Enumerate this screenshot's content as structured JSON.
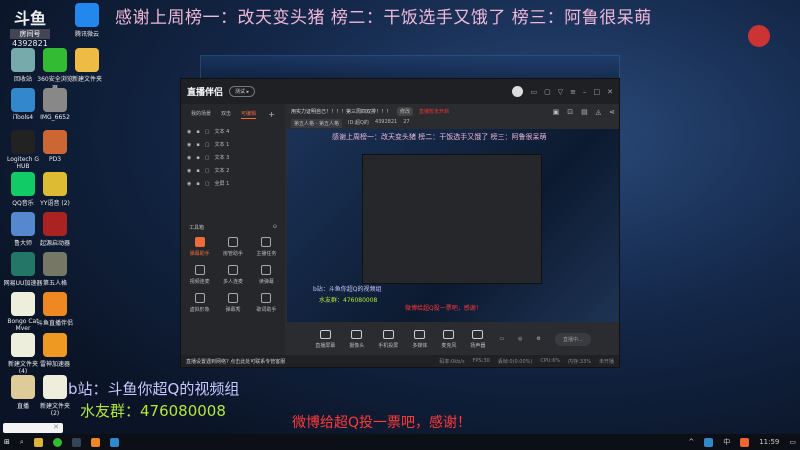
{
  "banner": "感谢上周榜一：改天变头猪 榜二：干饭选手又饿了 榜三：阿鲁很呆萌",
  "room": {
    "label": "房间号",
    "number": "4392821"
  },
  "desktop_icons": [
    {
      "label": "回收站",
      "color": "#7aa"
    },
    {
      "label": "360安全浏览器",
      "color": "#3b3"
    },
    {
      "label": "新建文件夹",
      "color": "#eb4"
    },
    {
      "label": "Logitech G HUB",
      "color": "#222"
    },
    {
      "label": "PD3",
      "color": "#c63"
    },
    {
      "label": "QQ音乐",
      "color": "#1c6"
    },
    {
      "label": "YY语音 (2)",
      "color": "#db3"
    },
    {
      "label": "鲁大师",
      "color": "#58c"
    },
    {
      "label": "起源启动器",
      "color": "#a22"
    },
    {
      "label": "网易UU加速器",
      "color": "#276"
    },
    {
      "label": "第五人格",
      "color": "#776"
    },
    {
      "label": "Bongo Cat Mver",
      "color": "#eed"
    },
    {
      "label": "斗鱼直播伴侣",
      "color": "#e82"
    },
    {
      "label": "新建文件夹 (4)",
      "color": "#eed"
    },
    {
      "label": "雷神加速器",
      "color": "#e92"
    },
    {
      "label": "直播",
      "color": "#dc9"
    },
    {
      "label": "新建文件夹 (2)",
      "color": "#eed"
    }
  ],
  "top_icons": [
    {
      "label": "iTools4",
      "color": "#38c"
    },
    {
      "label": "IMG_6652",
      "color": "#888"
    },
    {
      "label": "腾讯微云",
      "color": "#28e"
    }
  ],
  "app": {
    "logo": "直播伴侣",
    "version_pill": "测试 ▸",
    "tabs": [
      "我的场景",
      "双击",
      "可编辑"
    ],
    "active_tab": 2,
    "layers": [
      {
        "name": "文本 4"
      },
      {
        "name": "文本 1"
      },
      {
        "name": "文本 3"
      },
      {
        "name": "文本 2"
      },
      {
        "name": "全屏 1"
      }
    ],
    "tools_title": "工具箱",
    "tools": [
      "弹幕助手",
      "房管助手",
      "主播任务",
      "视频连麦",
      "多人连麦",
      "读弹幕",
      "虚拟形象",
      "弹幕秀",
      "歌词助手"
    ],
    "stream_title": "用实力证明自己！！！！第三周四双排！！！",
    "edit_label": "修改",
    "live_status": "直播暂未开启",
    "category": "第五人格 - 第五人格",
    "streamer_id": "ID:超Q的",
    "room_id": "4392821",
    "viewers": "27",
    "bottom_buttons": [
      "直播屏幕",
      "摄像头",
      "手机投屏",
      "多媒体",
      "麦克风",
      "扬声器"
    ],
    "start_button": "直播中...",
    "status_tip": "直播设置遇到网络? 点击此处可联系专管客服",
    "stats": [
      "码率:0kb/s",
      "FPS:30",
      "丢帧:0(0.00%)",
      "CPU:6%",
      "内存:33%",
      "未开播"
    ]
  },
  "overlays": {
    "bilibili": "b站：斗鱼你超Q的视频组",
    "qq_group": "水友群：476080008",
    "weibo": "微博给超Q投一票吧，感谢！"
  },
  "taskbar": {
    "time": "11:59",
    "ime": "中"
  }
}
